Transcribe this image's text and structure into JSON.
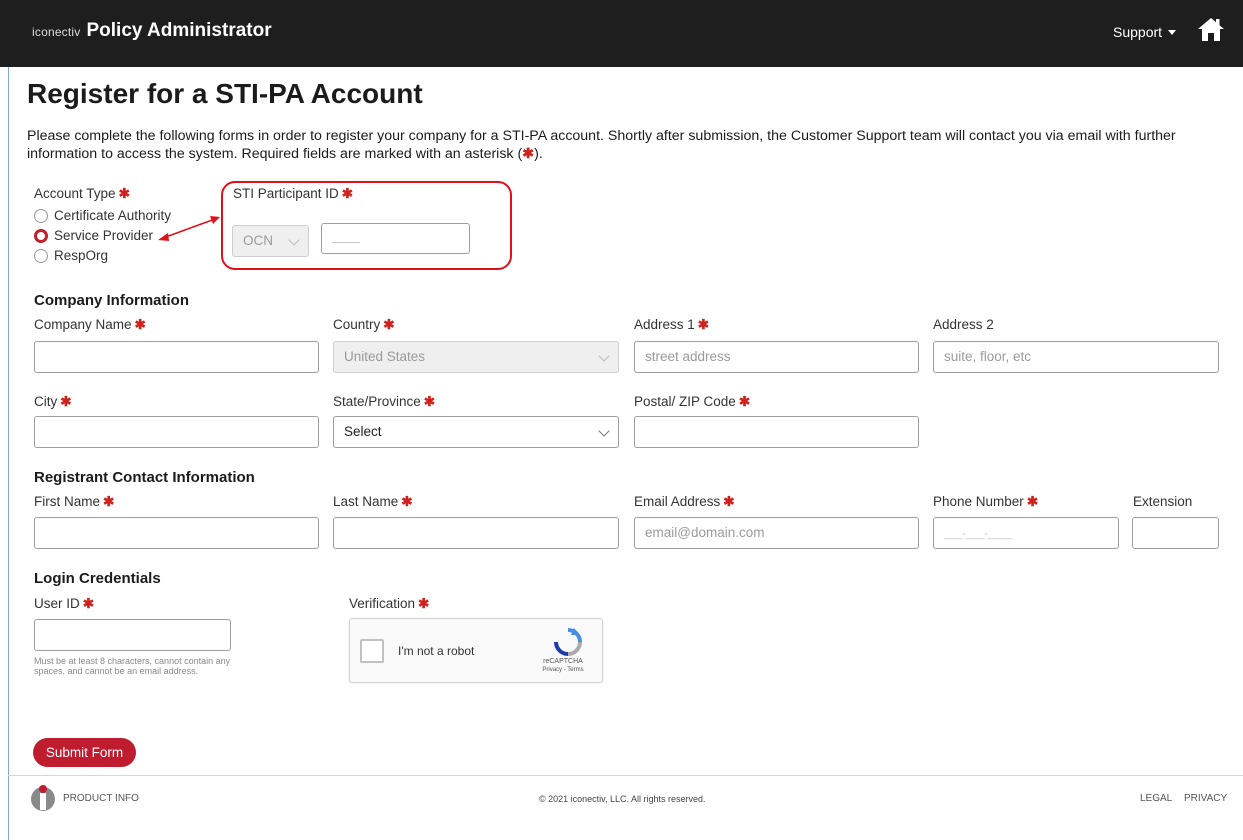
{
  "header": {
    "brand_small": "iconectiv",
    "brand_title": "Policy Administrator",
    "support_label": "Support"
  },
  "page": {
    "title": "Register for a STI-PA Account",
    "intro_before": "Please complete the following forms in order to register your company for a STI-PA account. Shortly after submission, the Customer Support team will contact you via email with further information to access the system. Required fields are marked with an asterisk (",
    "intro_star": "✱",
    "intro_after": ")."
  },
  "required_marker": "✱",
  "account_type": {
    "label": "Account Type",
    "options": [
      "Certificate Authority",
      "Service Provider",
      "RespOrg"
    ],
    "selected": "Service Provider"
  },
  "participant": {
    "label": "STI Participant ID",
    "type_value": "OCN"
  },
  "company": {
    "section_title": "Company Information",
    "name_label": "Company Name",
    "country_label": "Country",
    "country_value": "United States",
    "address1_label": "Address 1",
    "address1_placeholder": "street address",
    "address2_label": "Address 2",
    "address2_placeholder": "suite, floor, etc",
    "city_label": "City",
    "state_label": "State/Province",
    "state_value": "Select",
    "zip_label": "Postal/ ZIP Code"
  },
  "contact": {
    "section_title": "Registrant Contact Information",
    "first_label": "First Name",
    "last_label": "Last Name",
    "email_label": "Email Address",
    "email_placeholder": "email@domain.com",
    "phone_label": "Phone Number",
    "phone_placeholder": "___-___-____",
    "extension_label": "Extension"
  },
  "login": {
    "section_title": "Login Credentials",
    "userid_label": "User ID",
    "userid_help": "Must be at least 8 characters, cannot contain any spaces, and cannot be an email address.",
    "verification_label": "Verification"
  },
  "captcha": {
    "text": "I'm not a robot",
    "brand": "reCAPTCHA",
    "links": "Privacy - Terms"
  },
  "submit_label": "Submit Form",
  "footer": {
    "product_info": "PRODUCT INFO",
    "copyright": "© 2021 iconectiv, LLC. All rights reserved.",
    "legal": "LEGAL",
    "privacy": "PRIVACY"
  },
  "colors": {
    "accent_red": "#c01c2f",
    "header_bg": "#1e1e1e",
    "annotation_red": "#e0111b"
  },
  "icons": {
    "home": "home-icon",
    "support_caret": "chevron-down-icon",
    "recaptcha": "recaptcha-logo-icon",
    "footer_logo": "iconectiv-logo-icon"
  }
}
